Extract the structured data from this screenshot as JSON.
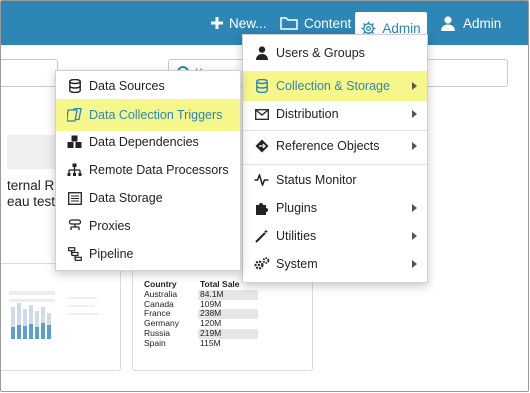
{
  "topbar": {
    "new_label": "New...",
    "content_label": "Content",
    "admin_tab_label": "Admin",
    "user_label": "Admin",
    "color": "#2d86b5"
  },
  "background": {
    "search_placeholder_fragment": "K",
    "text_fragment_1": "ternal R",
    "text_fragment_2": "eau test"
  },
  "mini_table": {
    "headers": [
      "Country",
      "Total Sale"
    ],
    "rows": [
      [
        "Australia",
        "84.1M"
      ],
      [
        "Canada",
        "109M"
      ],
      [
        "France",
        "238M"
      ],
      [
        "Germany",
        "120M"
      ],
      [
        "Russia",
        "219M"
      ],
      [
        "Spain",
        "115M"
      ]
    ]
  },
  "admin_menu": {
    "items": [
      {
        "label": "Users & Groups",
        "icon": "user-icon"
      },
      {
        "label": "Collection & Storage",
        "icon": "database-icon",
        "highlighted": true
      },
      {
        "label": "Distribution",
        "icon": "envelope-icon"
      },
      {
        "label": "Reference Objects",
        "icon": "reference-icon"
      },
      {
        "label": "Status Monitor",
        "icon": "pulse-icon"
      },
      {
        "label": "Plugins",
        "icon": "puzzle-icon"
      },
      {
        "label": "Utilities",
        "icon": "wand-icon"
      },
      {
        "label": "System",
        "icon": "gears-icon"
      }
    ]
  },
  "collection_submenu": {
    "items": [
      {
        "label": "Data Sources",
        "icon": "database-icon"
      },
      {
        "label": "Data Collection Triggers",
        "icon": "trigger-icon",
        "highlighted": true
      },
      {
        "label": "Data Dependencies",
        "icon": "cubes-icon"
      },
      {
        "label": "Remote Data Processors",
        "icon": "sitemap-icon"
      },
      {
        "label": "Data Storage",
        "icon": "storage-icon"
      },
      {
        "label": "Proxies",
        "icon": "proxy-icon"
      },
      {
        "label": "Pipeline",
        "icon": "pipeline-icon"
      }
    ]
  },
  "highlight_color": "#f5f78a"
}
